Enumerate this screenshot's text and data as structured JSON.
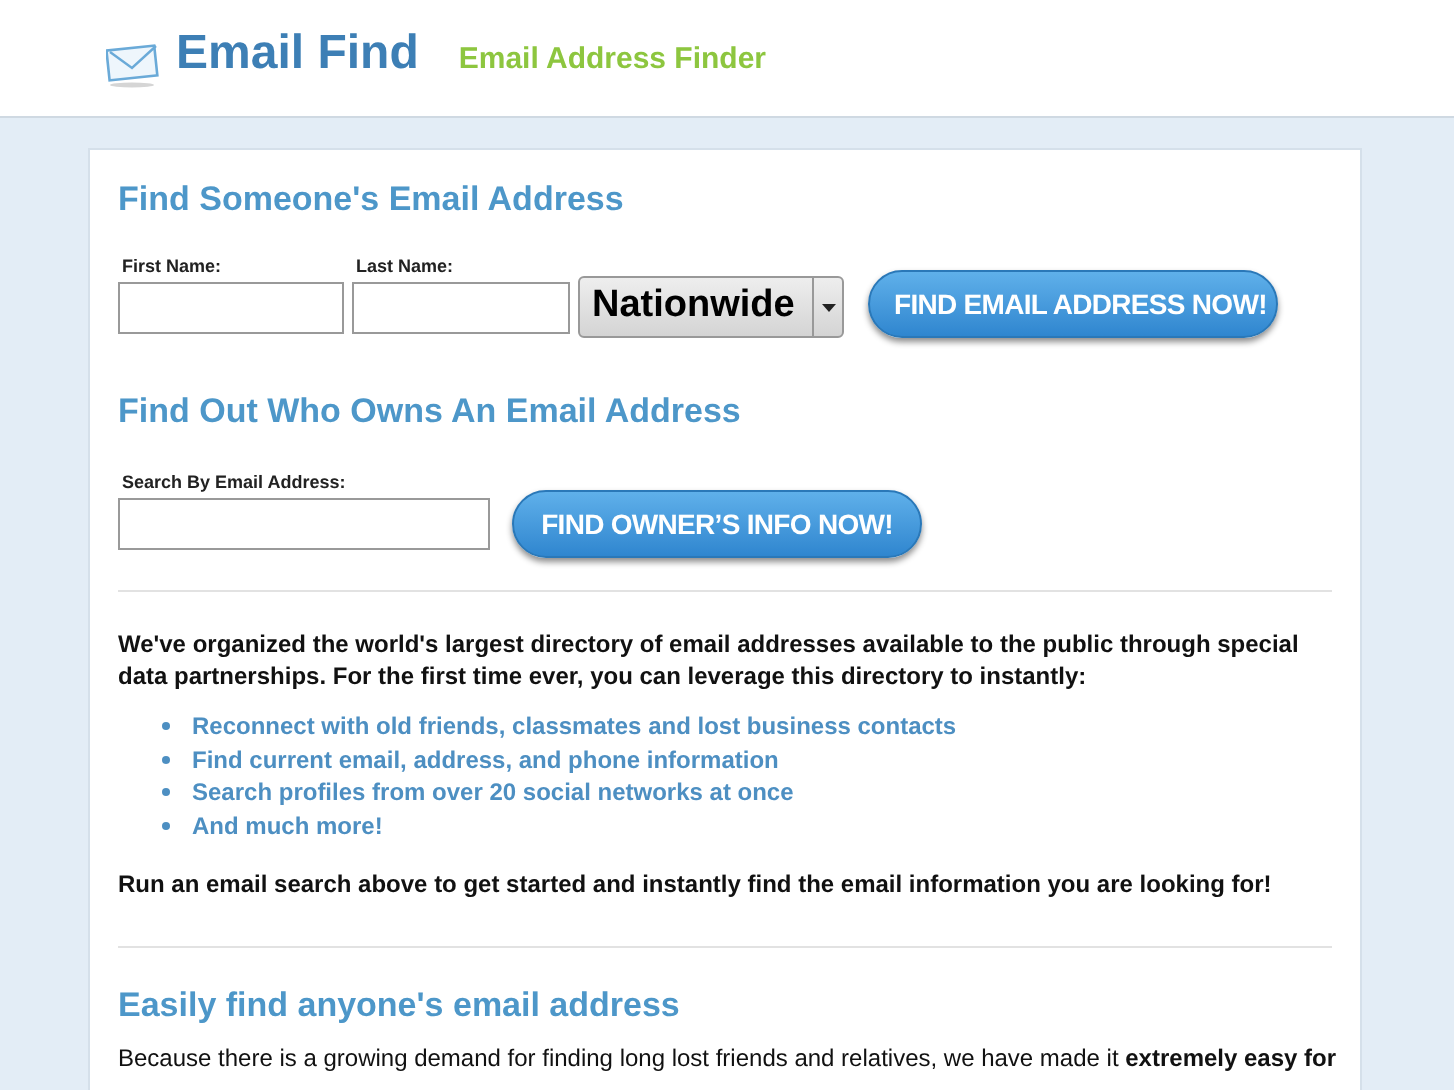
{
  "header": {
    "logo": "Email Find",
    "tagline": "Email Address Finder"
  },
  "name_search": {
    "title": "Find Someone's Email Address",
    "first_name_label": "First Name:",
    "last_name_label": "Last Name:",
    "region": "Nationwide",
    "button": "FIND EMAIL ADDRESS NOW!"
  },
  "owner_search": {
    "title": "Find Out Who Owns An Email Address",
    "email_label": "Search By Email Address:",
    "button": "FIND OWNER’S INFO NOW!"
  },
  "intro": "We've organized the world's largest directory of email addresses available to the public through special data partnerships. For the first time ever, you can leverage this directory to instantly:",
  "features": [
    "Reconnect with old friends, classmates and lost business contacts",
    "Find current email, address, and phone information",
    "Search profiles from over 20 social networks at once",
    "And much more!"
  ],
  "call_to_action": "Run an email search above to get started and instantly find the email information you are looking for!",
  "section": {
    "title": "Easily find anyone's email address",
    "text": "Because there is a growing demand for finding long lost friends and relatives, we have made it **extremely easy for**"
  }
}
